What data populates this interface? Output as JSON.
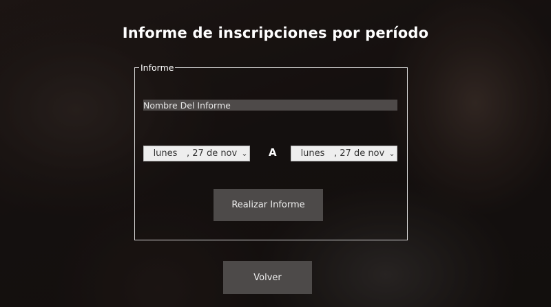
{
  "header": {
    "title": "Informe de inscripciones por período"
  },
  "form": {
    "legend": "Informe",
    "name_field": {
      "placeholder": "Nombre Del Informe",
      "value": ""
    },
    "date_from": {
      "day": "lunes",
      "rest": ", 27 de nov",
      "chevron": "⌄"
    },
    "separator": "A",
    "date_to": {
      "day": "lunes",
      "rest": ", 27 de nov",
      "chevron": "⌄"
    },
    "submit_label": "Realizar Informe"
  },
  "footer": {
    "back_label": "Volver"
  }
}
